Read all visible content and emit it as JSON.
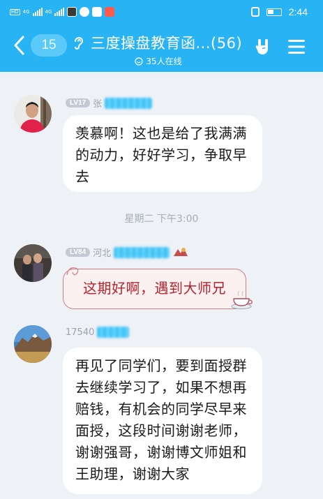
{
  "status_bar": {
    "sim_labels": [
      "HD",
      "HD"
    ],
    "network_labels": [
      "4G",
      "4G"
    ],
    "time": "2:44"
  },
  "header": {
    "unread_count": "15",
    "title": "三度操盘教育函...(56)",
    "online_status": "35人在线"
  },
  "colors": {
    "header_bg": "#28b3f4",
    "chat_bg": "#eef1f6",
    "bubble_bg": "#ffffff",
    "special_bubble_text": "#b7242e"
  },
  "messages": [
    {
      "level": "LV17",
      "sender_name_visible": "张",
      "text": "羡慕啊！这也是给了我满满的动力，好好学习，争取早去"
    },
    {
      "level": "LV84",
      "sender_name_visible": "河北",
      "text": "这期好啊，遇到大师兄"
    },
    {
      "level": "",
      "sender_name_visible": "17540",
      "text": "再见了同学们，要到面授群去继续学习了，如果不想再赔钱，有机会的同学尽早来面授，这段时间谢谢老师，谢谢强哥，谢谢博文师姐和王助理，谢谢大家"
    }
  ],
  "timestamp": "星期二 下午3:00"
}
